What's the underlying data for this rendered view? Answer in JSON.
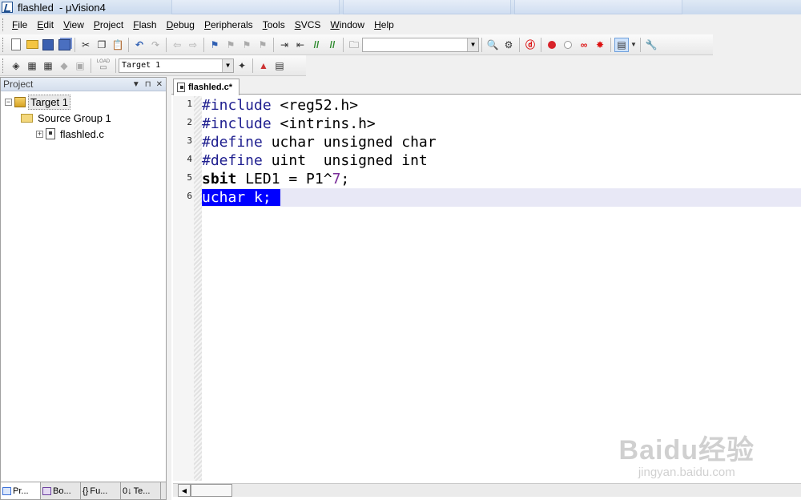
{
  "window": {
    "title": "flashled  - μVision4"
  },
  "menu": [
    "File",
    "Edit",
    "View",
    "Project",
    "Flash",
    "Debug",
    "Peripherals",
    "Tools",
    "SVCS",
    "Window",
    "Help"
  ],
  "toolbar": {
    "find_combo_value": "",
    "target_combo_value": "Target 1",
    "load_label": "LOAD"
  },
  "project_panel": {
    "header": "Project",
    "tree": [
      {
        "label": "Target 1",
        "level": 0,
        "expander": "−",
        "icon": "target-icon"
      },
      {
        "label": "Source Group 1",
        "level": 1,
        "expander": "",
        "icon": "folder-icon"
      },
      {
        "label": "flashled.c",
        "level": 2,
        "expander": "+",
        "icon": "file-icon"
      }
    ],
    "tabs": [
      {
        "label": "Pr...",
        "icon": "project-icon"
      },
      {
        "label": "Bo...",
        "icon": "books-icon"
      },
      {
        "label": "Fu...",
        "icon": "functions-icon"
      },
      {
        "label": "Te...",
        "icon": "templates-icon"
      }
    ]
  },
  "editor": {
    "tab_label": "flashled.c*",
    "line_numbers": [
      "1",
      "2",
      "3",
      "4",
      "5",
      "6"
    ],
    "current_line": 6
  },
  "watermark": {
    "logo": "Baidu经验",
    "url": "jingyan.baidu.com"
  },
  "colors": {
    "selection": "#0000ff",
    "current_line": "#e8e8f6",
    "preprocessor": "#1f1f8f"
  }
}
